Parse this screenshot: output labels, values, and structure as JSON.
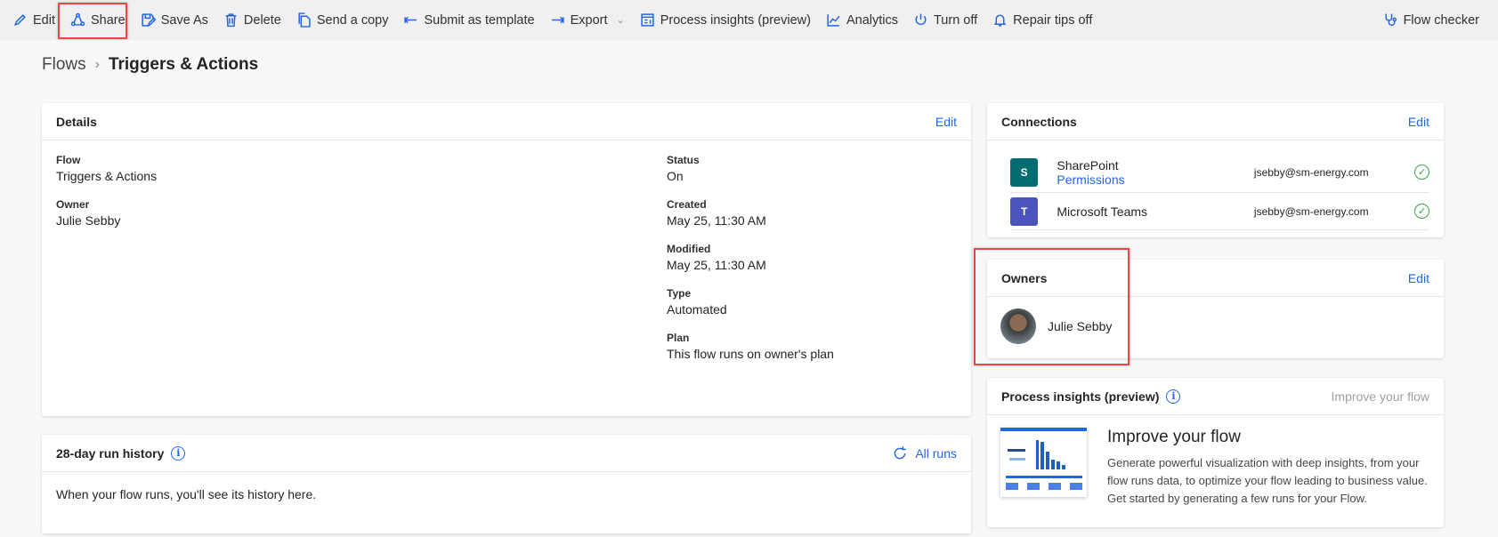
{
  "toolbar": {
    "items": [
      {
        "label": "Edit",
        "icon": "pencil-icon"
      },
      {
        "label": "Share",
        "icon": "share-icon"
      },
      {
        "label": "Save As",
        "icon": "save-as-icon"
      },
      {
        "label": "Delete",
        "icon": "trash-icon"
      },
      {
        "label": "Send a copy",
        "icon": "copy-icon"
      },
      {
        "label": "Submit as template",
        "icon": "arrow-left-icon"
      },
      {
        "label": "Export",
        "icon": "arrow-right-icon"
      },
      {
        "label": "Process insights (preview)",
        "icon": "process-icon"
      },
      {
        "label": "Analytics",
        "icon": "chart-icon"
      },
      {
        "label": "Turn off",
        "icon": "power-icon"
      },
      {
        "label": "Repair tips off",
        "icon": "bell-icon"
      }
    ],
    "flow_checker": "Flow checker"
  },
  "breadcrumb": {
    "root": "Flows",
    "current": "Triggers & Actions"
  },
  "details": {
    "title": "Details",
    "edit": "Edit",
    "flow_label": "Flow",
    "flow": "Triggers & Actions",
    "owner_label": "Owner",
    "owner": "Julie Sebby",
    "status_label": "Status",
    "status": "On",
    "created_label": "Created",
    "created": "May 25, 11:30 AM",
    "modified_label": "Modified",
    "modified": "May 25, 11:30 AM",
    "type_label": "Type",
    "type": "Automated",
    "plan_label": "Plan",
    "plan": "This flow runs on owner's plan"
  },
  "history": {
    "title": "28-day run history",
    "all_runs": "All runs",
    "empty": "When your flow runs, you'll see its history here."
  },
  "connections": {
    "title": "Connections",
    "edit": "Edit",
    "items": [
      {
        "name": "SharePoint",
        "sub": "Permissions",
        "email": "jsebby@sm-energy.com",
        "color": "#036c70"
      },
      {
        "name": "Microsoft Teams",
        "email": "jsebby@sm-energy.com",
        "color": "#4b53bc"
      }
    ]
  },
  "owners": {
    "title": "Owners",
    "edit": "Edit",
    "name": "Julie Sebby"
  },
  "insights": {
    "title": "Process insights (preview)",
    "action": "Improve your flow",
    "heading": "Improve your flow",
    "body": "Generate powerful visualization with deep insights, from your flow runs data, to optimize your flow leading to business value. Get started by generating a few runs for your Flow."
  }
}
